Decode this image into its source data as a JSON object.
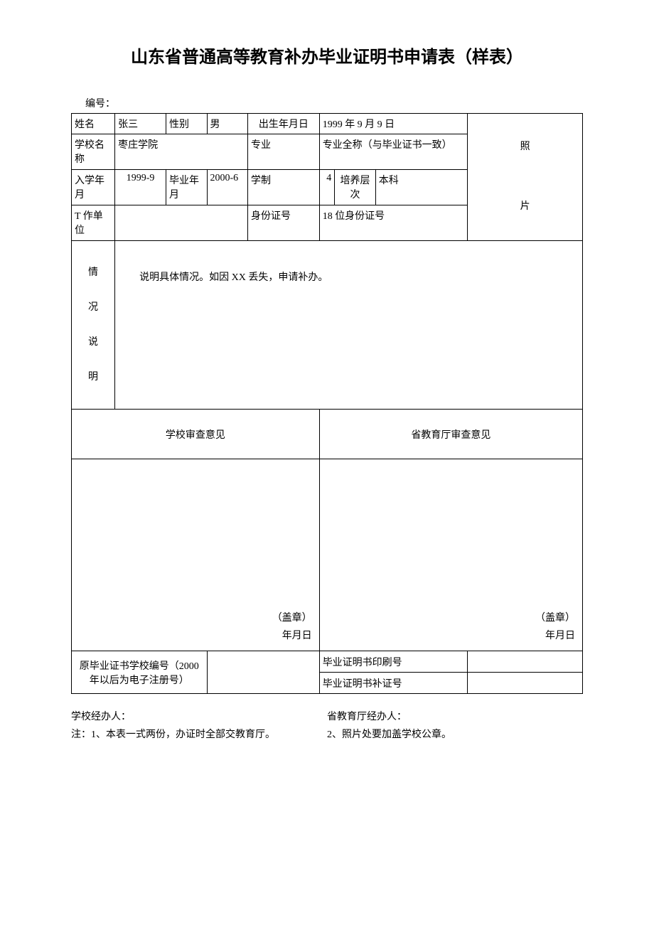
{
  "title": "山东省普通高等教育补办毕业证明书申请表（样表）",
  "serial_label": "编号：",
  "labels": {
    "name": "姓名",
    "gender": "性别",
    "birth": "出生年月日",
    "school": "学校名称",
    "major": "专业",
    "enroll": "入学年月",
    "grad": "毕业年月",
    "duration": "学制",
    "level": "培养层次",
    "workplace": "T 作单位",
    "idno": "身份证号",
    "situation": "情\n\n况\n\n说\n\n明",
    "school_opinion": "学校审查意见",
    "dept_opinion": "省教育厅审查意见",
    "seal": "（盖章）",
    "date": "年月日",
    "orig_no": "原毕业证书学校编号（2000 年以后为电子注册号）",
    "print_no": "毕业证明书印刷号",
    "supp_no": "毕业证明书补证号",
    "photo": "照",
    "photo2": "片"
  },
  "values": {
    "name": "张三",
    "gender": "男",
    "birth": "1999 年 9 月 9 日",
    "school": "枣庄学院",
    "major": "专业全称（与毕业证书一致）",
    "enroll": "1999-9",
    "grad": "2000-6",
    "duration": "4",
    "level": "本科",
    "workplace": "",
    "idno": "18 位身份证号",
    "situation": "说明具体情况。如因 XX 丢失，申请补办。",
    "orig_no": "",
    "print_no": "",
    "supp_no": ""
  },
  "footer": {
    "school_handler": "学校经办人：",
    "dept_handler": "省教育厅经办人：",
    "note1": "注：1、本表一式两份，办证时全部交教育厅。",
    "note2": "2、照片处要加盖学校公章。"
  }
}
